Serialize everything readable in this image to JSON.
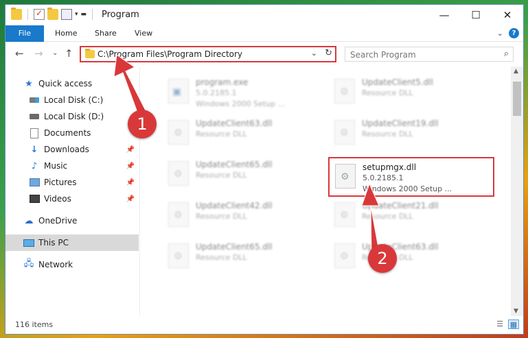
{
  "window": {
    "title": "Program",
    "controls": {
      "minimize": "—",
      "maximize": "☐",
      "close": "✕"
    }
  },
  "ribbon": {
    "tabs": [
      "File",
      "Home",
      "Share",
      "View"
    ]
  },
  "navbar": {
    "address": "C:\\Program Files\\Program Directory",
    "search_placeholder": "Search Program"
  },
  "sidebar": {
    "items": [
      {
        "label": "Quick access",
        "icon": "star-icon"
      },
      {
        "label": "Local Disk (C:)",
        "icon": "disk-icon"
      },
      {
        "label": "Local Disk (D:)",
        "icon": "disk-icon"
      },
      {
        "label": "Documents",
        "icon": "documents-icon",
        "pinned": true
      },
      {
        "label": "Downloads",
        "icon": "downloads-icon",
        "pinned": true
      },
      {
        "label": "Music",
        "icon": "music-icon",
        "pinned": true
      },
      {
        "label": "Pictures",
        "icon": "pictures-icon",
        "pinned": true
      },
      {
        "label": "Videos",
        "icon": "videos-icon",
        "pinned": true
      },
      {
        "label": "OneDrive",
        "icon": "onedrive-icon"
      },
      {
        "label": "This PC",
        "icon": "this-pc-icon",
        "selected": true
      },
      {
        "label": "Network",
        "icon": "network-icon"
      }
    ]
  },
  "files": [
    {
      "name": "program.exe",
      "type": "5.0.2185.1",
      "desc": "Windows 2000 Setup ..."
    },
    {
      "name": "UpdateClient5.dll",
      "type": "Resource DLL"
    },
    {
      "name": "UpdateClient63.dll",
      "type": "Resource DLL"
    },
    {
      "name": "UpdateClient19.dll",
      "type": "Resource DLL"
    },
    {
      "name": "UpdateClient65.dll",
      "type": "Resource DLL"
    },
    {
      "name": "setupmgx.dll",
      "type": "5.0.2185.1",
      "desc": "Windows 2000 Setup ..."
    },
    {
      "name": "UpdateClient42.dll",
      "type": "Resource DLL"
    },
    {
      "name": "UpdateClient21.dll",
      "type": "Resource DLL"
    },
    {
      "name": "UpdateClient65.dll",
      "type": "Resource DLL"
    },
    {
      "name": "UpdateClient63.dll",
      "type": "Resource DLL"
    }
  ],
  "status": {
    "item_count": "116 items"
  },
  "annotations": {
    "callout_1": "1",
    "callout_2": "2",
    "color": "#d9383a"
  }
}
